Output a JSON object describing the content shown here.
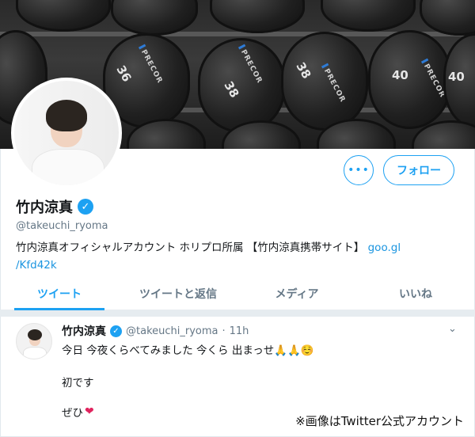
{
  "profile": {
    "name": "竹内涼真",
    "handle": "@takeuchi_ryoma",
    "bio_text": "竹内涼真オフィシャルアカウント ホリプロ所属 【竹内涼真携帯サイト】",
    "bio_link_part1": "goo.gl",
    "bio_link_part2": "/Kfd42k",
    "verified_icon": "verified-check-icon"
  },
  "actions": {
    "more_label": "•••",
    "follow_label": "フォロー"
  },
  "banner": {
    "weights": [
      "36",
      "38",
      "38",
      "40",
      "40"
    ],
    "brand": "PRECOR"
  },
  "tabs": [
    {
      "label": "ツイート",
      "active": true
    },
    {
      "label": "ツイートと返信",
      "active": false
    },
    {
      "label": "メディア",
      "active": false
    },
    {
      "label": "いいね",
      "active": false
    }
  ],
  "tweet": {
    "name": "竹内涼真",
    "handle": "@takeuchi_ryoma",
    "dot": "·",
    "time": "11h",
    "line1": "今日 今夜くらべてみました 今くら 出まっせ🙏🙏☺️",
    "line2": "初です",
    "line3": "ぜひ",
    "heart": "❤"
  },
  "caption": "※画像はTwitter公式アカウント",
  "colors": {
    "accent": "#1da1f2",
    "link": "#1b95e0",
    "muted": "#657786",
    "heart": "#e0245e"
  }
}
